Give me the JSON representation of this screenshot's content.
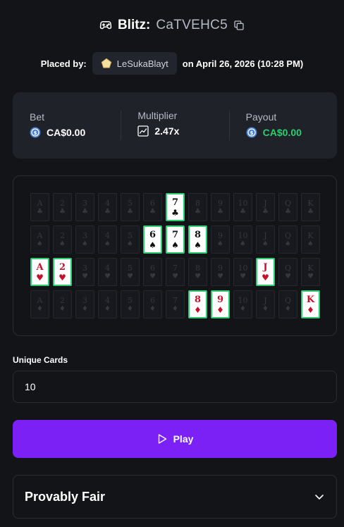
{
  "header": {
    "game_name": "Blitz:",
    "bet_id": "CaTVEHC5",
    "game_icon": "gamepad-icon",
    "copy_icon": "copy-icon"
  },
  "placed_by": {
    "label": "Placed by:",
    "username": "LeSukaBlayt",
    "user_badge_icon": "pentagon-badge-icon",
    "date_text": "on April 26, 2026 (10:28 PM)"
  },
  "stats": {
    "bet": {
      "label": "Bet",
      "value": "CA$0.00",
      "icon": "currency-coin-icon"
    },
    "multiplier": {
      "label": "Multiplier",
      "value": "2.47x",
      "icon": "chart-icon"
    },
    "payout": {
      "label": "Payout",
      "value": "CA$0.00",
      "icon": "currency-coin-icon"
    }
  },
  "board": {
    "ranks": [
      "A",
      "2",
      "3",
      "4",
      "5",
      "6",
      "7",
      "8",
      "9",
      "10",
      "J",
      "Q",
      "K"
    ],
    "rows": [
      {
        "suit": "♣",
        "color": "black",
        "active": [
          "7"
        ]
      },
      {
        "suit": "♠",
        "color": "black",
        "active": [
          "6",
          "7",
          "8"
        ]
      },
      {
        "suit": "♥",
        "color": "red",
        "active": [
          "A",
          "2",
          "J"
        ]
      },
      {
        "suit": "♦",
        "color": "red",
        "active": [
          "8",
          "9",
          "K"
        ]
      }
    ]
  },
  "unique_cards": {
    "label": "Unique Cards",
    "value": "10"
  },
  "play_button": {
    "label": "Play",
    "icon": "play-icon"
  },
  "provably_fair": {
    "title": "Provably Fair",
    "icon": "chevron-down-icon"
  },
  "colors": {
    "background": "#131418",
    "panel": "#1f2229",
    "accent_purple": "#7c21f5",
    "payout_green": "#2ecc71",
    "card_red": "#c8102e"
  }
}
